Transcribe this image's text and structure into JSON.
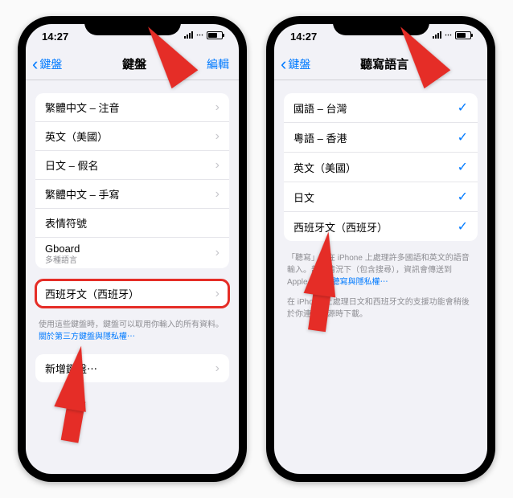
{
  "left_phone": {
    "status_time": "14:27",
    "back_label": "鍵盤",
    "title": "鍵盤",
    "edit_label": "編輯",
    "keyboards": [
      "繁體中文 – 注音",
      "英文（美國）",
      "日文 – 假名",
      "繁體中文 – 手寫",
      "表情符號"
    ],
    "gboard_label": "Gboard",
    "gboard_subtitle": "多種語言",
    "highlighted_keyboard": "西班牙文（西班牙）",
    "privacy_note_pre": "使用這些鍵盤時，鍵盤可以取用你輸入的所有資料。",
    "privacy_link": "關於第三方鍵盤與隱私權⋯",
    "add_keyboard_label": "新增鍵盤⋯"
  },
  "right_phone": {
    "status_time": "14:27",
    "back_label": "鍵盤",
    "title": "聽寫語言",
    "languages": [
      "國語 – 台灣",
      "粵語 – 香港",
      "英文（美國）",
      "日文",
      "西班牙文（西班牙）"
    ],
    "note1_pre": "「聽寫」可在 iPhone 上處理許多國語和英文的語音輸入。部分情況下（包含搜尋），資訊會傳送到 Apple。",
    "note1_link": "關於聽寫與隱私權⋯",
    "note2": "在 iPhone 上處理日文和西班牙文的支援功能會稍後於你連接電源時下載。"
  }
}
